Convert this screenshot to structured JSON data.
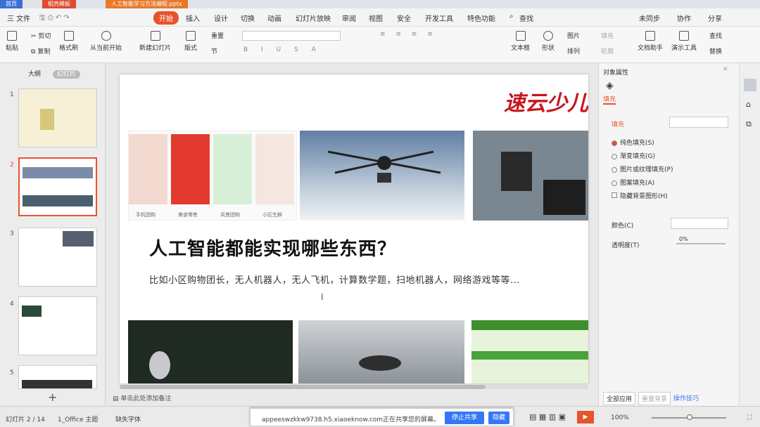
{
  "titlebar": {
    "tab1": "首页",
    "tab2": "稻壳模板",
    "tab3": "人工智能学习方法编程.pptx"
  },
  "menu": {
    "file": "三 文件",
    "items": [
      "开始",
      "插入",
      "设计",
      "切换",
      "动画",
      "幻灯片放映",
      "审阅",
      "视图",
      "安全",
      "开发工具",
      "特色功能"
    ],
    "search": "查找",
    "sync": "未同步",
    "collab": "协作",
    "share": "分享"
  },
  "ribbon": {
    "paste": "粘贴",
    "cut": "剪切",
    "copy": "复制",
    "format_painter": "格式刷",
    "from_current": "从当前开始",
    "new_slide": "新建幻灯片",
    "layout": "版式",
    "reset": "重置",
    "section": "节",
    "textbox": "文本框",
    "shape": "形状",
    "picture": "图片",
    "arrange": "排列",
    "fill": "填充",
    "outline": "轮廓",
    "text_assist": "文档助手",
    "present_tool": "演示工具",
    "find": "查找",
    "replace": "替换"
  },
  "sidebar": {
    "tab_outline": "大纲",
    "tab_slides": "幻灯片",
    "thumbs": [
      {
        "num": "1"
      },
      {
        "num": "2"
      },
      {
        "num": "3"
      },
      {
        "num": "4"
      },
      {
        "num": "5"
      }
    ],
    "add": "+"
  },
  "slide": {
    "logo": "速云少儿",
    "title": "人工智能都能实现哪些东西？",
    "subtitle": "比如小区购物团长，无人机器人，无人飞机，计算数学题，扫地机器人，网络游戏等等...",
    "captions": [
      "手机团购",
      "美食零售",
      "风景团购",
      "小区生鲜"
    ]
  },
  "panel": {
    "header": "对象属性",
    "tab_fill": "填充",
    "section_fill": "填充",
    "options": [
      "纯色填充(S)",
      "渐变填充(G)",
      "图片或纹理填充(P)",
      "图案填充(A)"
    ],
    "hide_bg": "隐藏背景图形(H)",
    "color_label": "颜色(C)",
    "transparency_label": "透明度(T)",
    "transparency_value": "0%",
    "apply_all": "全部应用",
    "reset_bg": "重置背景",
    "tips": "操作技巧"
  },
  "notes": "单击此处添加备注",
  "status": {
    "slide_num": "幻灯片 2 / 14",
    "theme": "1_Office 主题",
    "font_missing": "缺失字体",
    "zoom": "100%"
  },
  "sharebar": {
    "text": "appeeswzkkw9738.h5.xiaoeknow.com正在共享您的屏幕。",
    "stop": "停止共享",
    "hide": "隐藏"
  },
  "colors": {
    "accent": "#e8532b",
    "brand_red": "#c8161d",
    "share_blue": "#3478f6"
  }
}
